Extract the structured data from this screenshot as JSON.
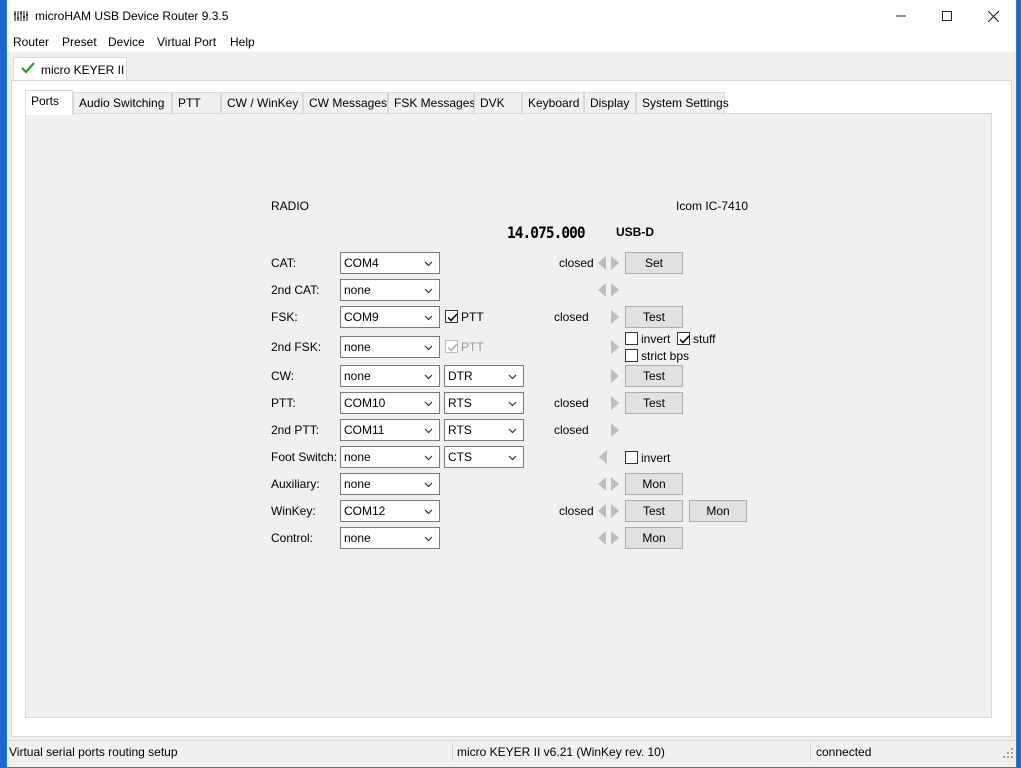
{
  "window": {
    "title": "microHAM USB Device Router 9.3.5"
  },
  "menu": [
    "Router",
    "Preset",
    "Device",
    "Virtual Port",
    "Help"
  ],
  "device_tab": {
    "label": "micro KEYER II",
    "status_icon": "check-icon"
  },
  "tabs": [
    "Ports",
    "Audio Switching",
    "PTT",
    "CW / WinKey",
    "CW Messages",
    "FSK Messages",
    "DVK",
    "Keyboard",
    "Display",
    "System Settings"
  ],
  "active_tab": "Ports",
  "radio": {
    "label": "RADIO",
    "model": "Icom IC-7410",
    "frequency": "14.075.000",
    "mode": "USB-D"
  },
  "ports": {
    "cat": {
      "label": "CAT:",
      "port": "COM4",
      "status": "closed",
      "button": "Set"
    },
    "cat2": {
      "label": "2nd CAT:",
      "port": "none"
    },
    "fsk": {
      "label": "FSK:",
      "port": "COM9",
      "ptt_label": "PTT",
      "ptt_checked": true,
      "status": "closed",
      "button": "Test"
    },
    "fsk_opts": {
      "invert_label": "invert",
      "invert_checked": false,
      "stuff_label": "stuff",
      "stuff_checked": true,
      "strict_label": "strict bps",
      "strict_checked": false
    },
    "fsk2": {
      "label": "2nd FSK:",
      "port": "none",
      "ptt_label": "PTT",
      "ptt_checked": true
    },
    "cw": {
      "label": "CW:",
      "port": "none",
      "line": "DTR",
      "button": "Test"
    },
    "ptt": {
      "label": "PTT:",
      "port": "COM10",
      "line": "RTS",
      "status": "closed",
      "button": "Test"
    },
    "ptt2": {
      "label": "2nd PTT:",
      "port": "COM11",
      "line": "RTS",
      "status": "closed"
    },
    "foot": {
      "label": "Foot Switch:",
      "port": "none",
      "line": "CTS",
      "invert_label": "invert",
      "invert_checked": false
    },
    "aux": {
      "label": "Auxiliary:",
      "port": "none",
      "button": "Mon"
    },
    "winkey": {
      "label": "WinKey:",
      "port": "COM12",
      "status": "closed",
      "button": "Test",
      "button2": "Mon"
    },
    "control": {
      "label": "Control:",
      "port": "none",
      "button": "Mon"
    }
  },
  "status": {
    "left": "Virtual serial ports routing setup",
    "middle": "micro KEYER II v6.21 (WinKey rev. 10)",
    "right": "connected"
  }
}
